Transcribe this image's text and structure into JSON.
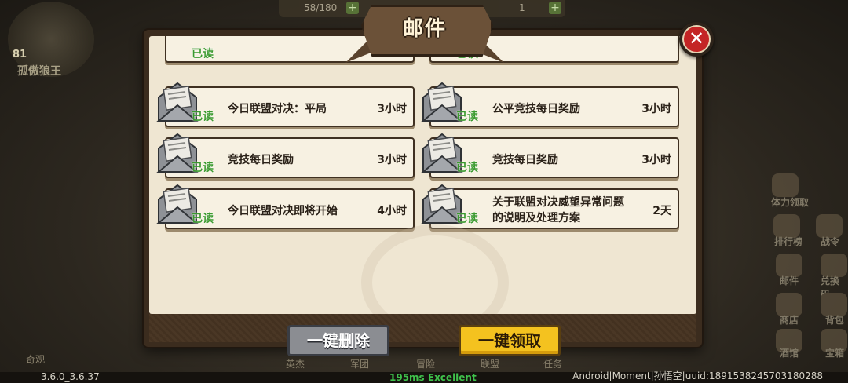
{
  "hud": {
    "level": "81",
    "player_name": "孤傲狼王",
    "stamina": "58/180",
    "gem_count": "1",
    "plus": "+",
    "side_labels": [
      "体力领取",
      "排行榜",
      "战令",
      "邮件",
      "兑换码",
      "商店",
      "背包",
      "酒馆",
      "宝箱"
    ],
    "bottom_labels": [
      "奇观",
      "英杰",
      "军团",
      "冒险",
      "联盟",
      "任务"
    ],
    "version": "3.6.0_3.6.37",
    "ping": "195ms Excellent",
    "uid_line": "Android|Moment|孙悟空|uuid:1891538245703180288"
  },
  "dialog": {
    "title": "邮件",
    "close_symbol": "✕",
    "mails": [
      {
        "status": "已读",
        "subject": "今日联盟对决：平局",
        "age": "3小时"
      },
      {
        "status": "已读",
        "subject": "公平竞技每日奖励",
        "age": "3小时"
      },
      {
        "status": "已读",
        "subject": "竞技每日奖励",
        "age": "3小时"
      },
      {
        "status": "已读",
        "subject": "竞技每日奖励",
        "age": "3小时"
      },
      {
        "status": "已读",
        "subject": "今日联盟对决即将开始",
        "age": "4小时"
      },
      {
        "status": "已读",
        "subject": "关于联盟对决威望异常问题的说明及处理方案",
        "age": "2天"
      }
    ],
    "partial_status": "已读",
    "delete_all": "一键删除",
    "claim_all": "一键领取"
  }
}
